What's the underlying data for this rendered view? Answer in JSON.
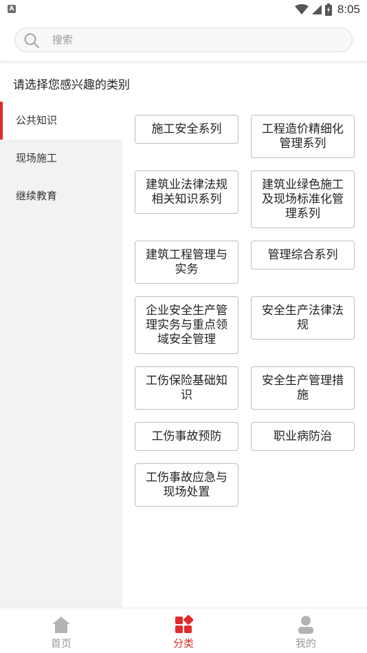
{
  "status_bar": {
    "app_badge": "A",
    "time": "8:05"
  },
  "search": {
    "placeholder": "搜索"
  },
  "prompt": {
    "title": "请选择您感兴趣的类别"
  },
  "sidebar": {
    "items": [
      {
        "label": "公共知识",
        "active": true
      },
      {
        "label": "现场施工",
        "active": false
      },
      {
        "label": "继续教育",
        "active": false
      }
    ]
  },
  "categories": [
    {
      "label": "施工安全系列"
    },
    {
      "label": "工程造价精细化管理系列"
    },
    {
      "label": "建筑业法律法规相关知识系列"
    },
    {
      "label": "建筑业绿色施工及现场标准化管理系列"
    },
    {
      "label": "建筑工程管理与实务"
    },
    {
      "label": "管理综合系列"
    },
    {
      "label": "企业安全生产管理实务与重点领域安全管理"
    },
    {
      "label": "安全生产法律法规"
    },
    {
      "label": "工伤保险基础知识"
    },
    {
      "label": "安全生产管理措施"
    },
    {
      "label": "工伤事故预防"
    },
    {
      "label": "职业病防治"
    },
    {
      "label": "工伤事故应急与现场处置"
    }
  ],
  "tabbar": {
    "items": [
      {
        "label": "首页",
        "icon": "home-icon"
      },
      {
        "label": "分类",
        "icon": "category-icon",
        "active": true
      },
      {
        "label": "我的",
        "icon": "user-icon"
      }
    ]
  },
  "colors": {
    "accent": "#e02b2b",
    "sidebar_bg": "#f1f2f1",
    "inactive": "#9a9a9a"
  }
}
